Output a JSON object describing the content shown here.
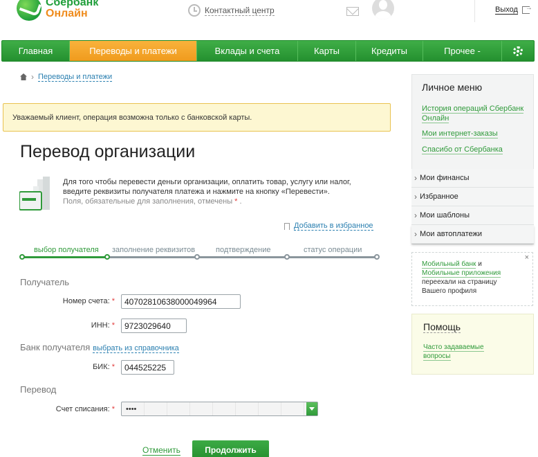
{
  "header": {
    "logo_line1": "Сбербанк",
    "logo_line2": "Онлайн",
    "contact_label": "Контактный центр",
    "exit_label": "Выход"
  },
  "nav": {
    "items": [
      {
        "label": "Главная"
      },
      {
        "label": "Переводы и платежи"
      },
      {
        "label": "Вклады и счета"
      },
      {
        "label": "Карты"
      },
      {
        "label": "Кредиты"
      },
      {
        "label": "Прочее -"
      }
    ],
    "active_index": 1
  },
  "breadcrumb": {
    "link": "Переводы и платежи"
  },
  "warning": "Уважаемый клиент, операция возможна только с банковской карты.",
  "page_title": "Перевод организации",
  "description": {
    "text": "Для того чтобы перевести деньги организации, оплатить товар, услугу или налог, введите реквизиты получателя платежа и нажмите на кнопку «Перевести».",
    "required_note": "Поля, обязательные для заполнения, отмечены",
    "star": "*",
    "dot": "."
  },
  "favorites_link": "Добавить в избранное",
  "steps": [
    {
      "label": "выбор получателя"
    },
    {
      "label": "заполнение реквизитов"
    },
    {
      "label": "подтверждение"
    },
    {
      "label": "статус операции"
    }
  ],
  "form": {
    "recipient_section": "Получатель",
    "account_label": "Номер счета:",
    "account_value": "40702810638000049964",
    "inn_label": "ИНН:",
    "inn_value": "9723029640",
    "bank_section": "Банк получателя",
    "bank_directory_link": "выбрать из справочника",
    "bik_label": "БИК:",
    "bik_value": "044525225",
    "transfer_section": "Перевод",
    "debit_label": "Счет списания:",
    "debit_value": "••••",
    "star": "*"
  },
  "actions": {
    "cancel": "Отменить",
    "continue": "Продолжить"
  },
  "sidebar": {
    "personal_menu_title": "Личное меню",
    "links": [
      "История операций Сбербанк Онлайн",
      "Мои интернет-заказы",
      "Спасибо от Сбербанка"
    ],
    "menu": [
      "Мои финансы",
      "Избранное",
      "Мои шаблоны",
      "Мои автоплатежи"
    ],
    "notice": {
      "link1": "Мобильный банк",
      "and": "и",
      "link2": "Мобильные приложения",
      "text": "переехали на страницу Вашего профиля",
      "close": "×"
    },
    "help_title": "Помощь",
    "help_link": "Часто задаваемые вопросы"
  },
  "colors": {
    "brand_green": "#2f9a3a",
    "nav_active_orange": "#f09b1d",
    "link_blue": "#2a7fb0",
    "warning_bg": "#fdf7d2"
  }
}
